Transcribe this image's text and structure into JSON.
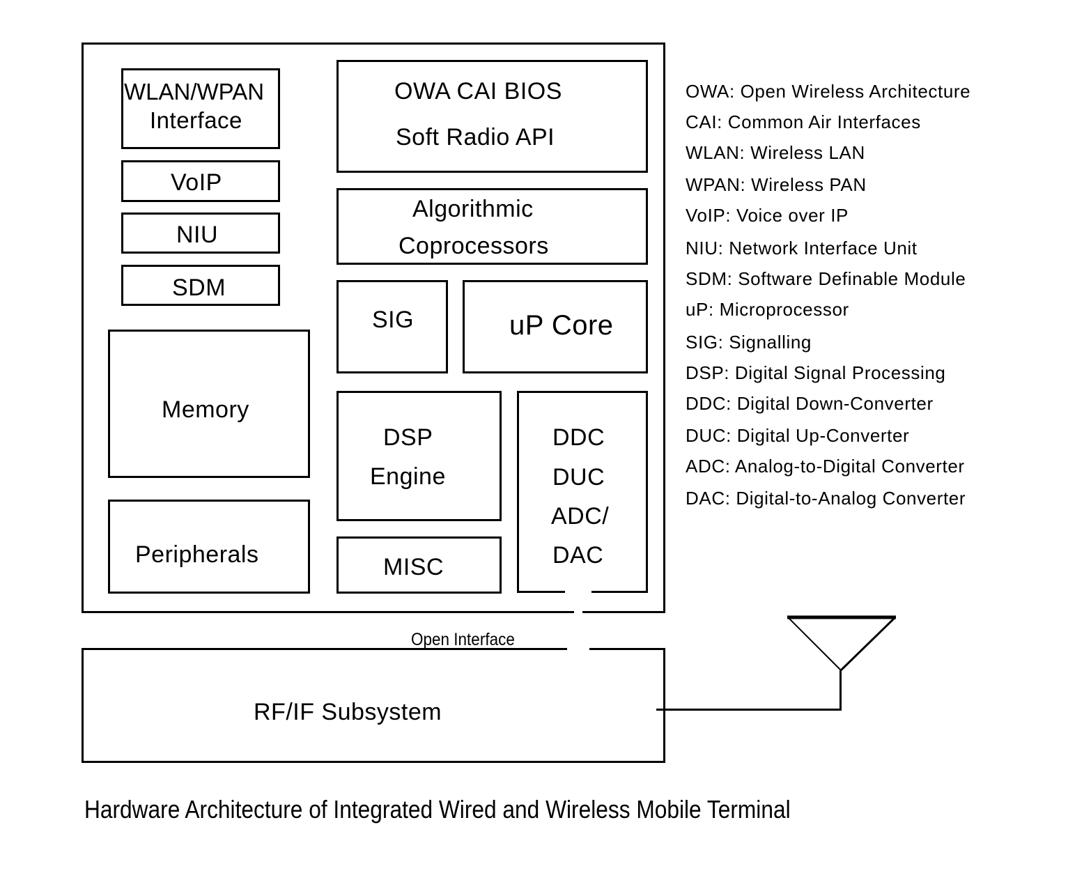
{
  "diagram": {
    "caption": "Hardware Architecture of Integrated Wired and Wireless Mobile Terminal",
    "terminal_blocks": {
      "wlan_wpan": [
        "WLAN/WPAN",
        "Interface"
      ],
      "voip": "VoIP",
      "niu": "NIU",
      "sdm": "SDM",
      "memory": "Memory",
      "peripherals": "Peripherals",
      "owa_cai_bios": [
        "OWA CAI BIOS",
        "Soft Radio API"
      ],
      "algorithmic": [
        "Algorithmic",
        "Coprocessors"
      ],
      "sig": "SIG",
      "up_core": "uP Core",
      "dsp_engine": [
        "DSP",
        "Engine"
      ],
      "misc": "MISC",
      "converters": [
        "DDC",
        "DUC",
        "ADC/",
        "DAC"
      ]
    },
    "open_interface_label": "Open Interface",
    "rf_subsystem": "RF/IF Subsystem",
    "antenna_icon": "antenna-icon",
    "legend": [
      "OWA: Open Wireless Architecture",
      "CAI: Common Air Interfaces",
      "WLAN: Wireless LAN",
      "WPAN: Wireless PAN",
      "VoIP: Voice over IP",
      "NIU: Network Interface Unit",
      "SDM: Software Definable Module",
      "uP: Microprocessor",
      "SIG: Signalling",
      "DSP: Digital Signal Processing",
      "DDC: Digital Down-Converter",
      "DUC: Digital Up-Converter",
      "ADC: Analog-to-Digital Converter",
      "DAC: Digital-to-Analog Converter"
    ]
  }
}
